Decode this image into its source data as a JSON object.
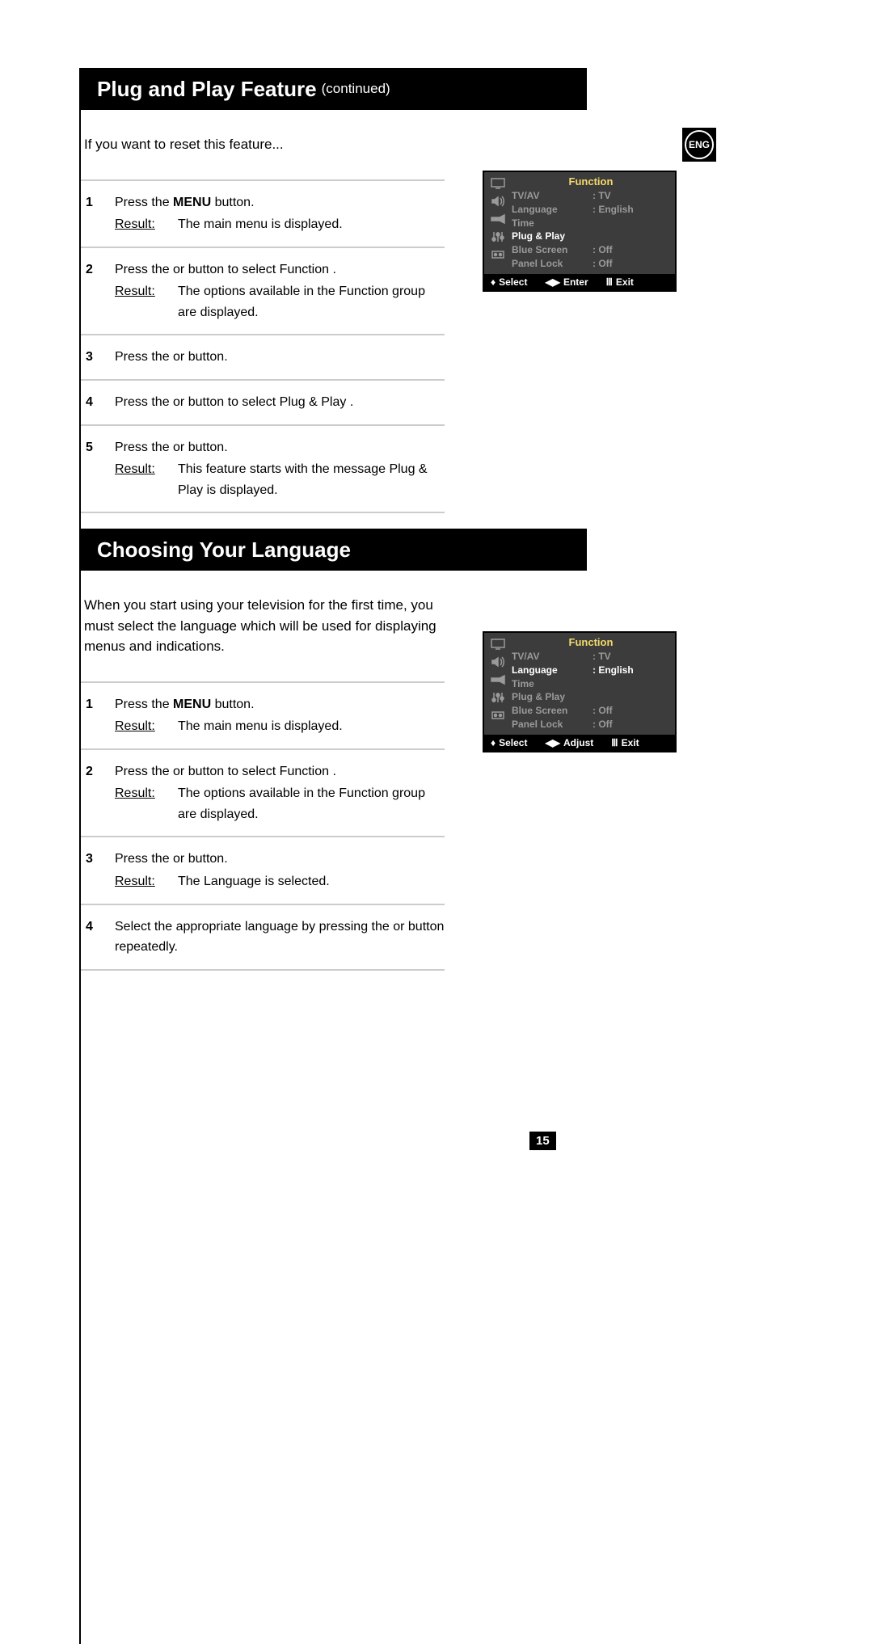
{
  "lang_badge": "ENG",
  "page_number": "15",
  "section1": {
    "title_main": "Plug and Play Feature",
    "title_sub": " (continued)",
    "intro": "If you want to reset this feature...",
    "steps": [
      {
        "line": "Press the MENU button.",
        "bold_token": "MENU",
        "result": "The main menu is displayed."
      },
      {
        "line": "Press the   or   button to select Function .",
        "result": "The options available in the Function  group are displayed."
      },
      {
        "line": "Press the   or   button."
      },
      {
        "line": "Press the   or   button to select Plug & Play ."
      },
      {
        "line": "Press the   or   button.",
        "result": "This feature starts with the message Plug & Play  is displayed."
      }
    ]
  },
  "section2": {
    "title_main": "Choosing Your Language",
    "intro": "When you start using your television for the first time, you must select the language which will be used for displaying menus and indications.",
    "steps": [
      {
        "line": "Press the MENU button.",
        "bold_token": "MENU",
        "result": "The main menu is displayed."
      },
      {
        "line": "Press the   or   button to select Function .",
        "result": "The options available in the Function  group are displayed."
      },
      {
        "line": "Press the   or   button.",
        "result": "The  Language  is selected."
      },
      {
        "line": "Select the appropriate language by pressing the   or   button repeatedly."
      }
    ]
  },
  "osd1": {
    "title": "Function",
    "rows": [
      {
        "label": "TV/AV",
        "value": ": TV",
        "selected": false
      },
      {
        "label": "Language",
        "value": ": English",
        "selected": false
      },
      {
        "label": "Time",
        "value": "",
        "selected": false
      },
      {
        "label": "Plug & Play",
        "value": "",
        "selected": true
      },
      {
        "label": "Blue Screen",
        "value": ": Off",
        "selected": false
      },
      {
        "label": "Panel Lock",
        "value": ": Off",
        "selected": false
      }
    ],
    "footer": {
      "select": "Select",
      "middle": "Enter",
      "exit": "Exit"
    }
  },
  "osd2": {
    "title": "Function",
    "rows": [
      {
        "label": "TV/AV",
        "value": ": TV",
        "selected": false
      },
      {
        "label": "Language",
        "value": ": English",
        "selected": true
      },
      {
        "label": "Time",
        "value": "",
        "selected": false
      },
      {
        "label": "Plug & Play",
        "value": "",
        "selected": false
      },
      {
        "label": "Blue Screen",
        "value": ": Off",
        "selected": false
      },
      {
        "label": "Panel Lock",
        "value": ": Off",
        "selected": false
      }
    ],
    "footer": {
      "select": "Select",
      "middle": "Adjust",
      "exit": "Exit"
    }
  },
  "result_label": "Result:"
}
